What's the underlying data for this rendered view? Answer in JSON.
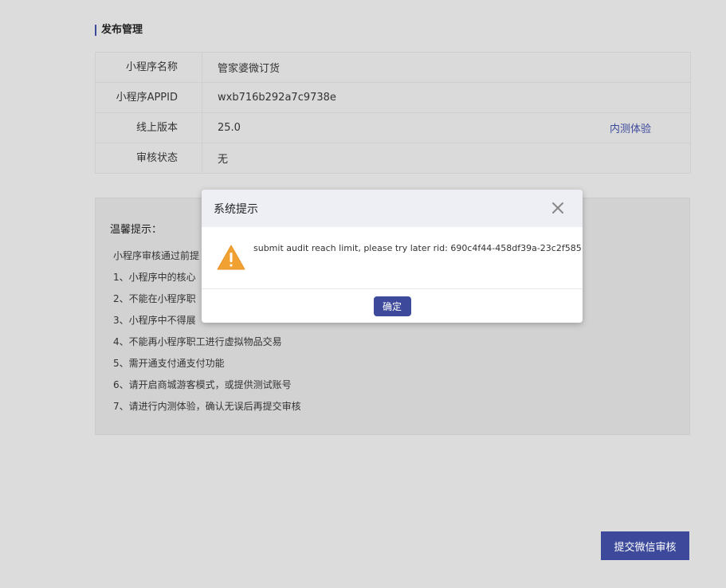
{
  "page": {
    "section_title": "发布管理"
  },
  "info": {
    "rows": [
      {
        "label": "小程序名称",
        "value": "管家婆微订货"
      },
      {
        "label": "小程序APPID",
        "value": "wxb716b292a7c9738e"
      },
      {
        "label": "线上版本",
        "value": "25.0",
        "link": "内测体验"
      },
      {
        "label": "审核状态",
        "value": "无"
      }
    ]
  },
  "tips": {
    "title": "温馨提示：",
    "items": [
      "小程序审核通过前提",
      "1、小程序中的核心",
      "2、不能在小程序职",
      "3、小程序中不得展",
      "4、不能再小程序职工进行虚拟物品交易",
      "5、需开通支付通支付功能",
      "6、请开启商城游客模式，或提供测试账号",
      "7、请进行内测体验，确认无误后再提交审核"
    ]
  },
  "actions": {
    "submit_label": "提交微信审核"
  },
  "modal": {
    "title": "系统提示",
    "message": "submit audit reach limit, please try later rid: 690c4f44-458df39a-23c2f585",
    "ok_label": "确定",
    "icon": "warning-icon",
    "close_icon": "close-icon"
  },
  "colors": {
    "accent": "#3d4a9c",
    "warning": "#f0a132"
  }
}
